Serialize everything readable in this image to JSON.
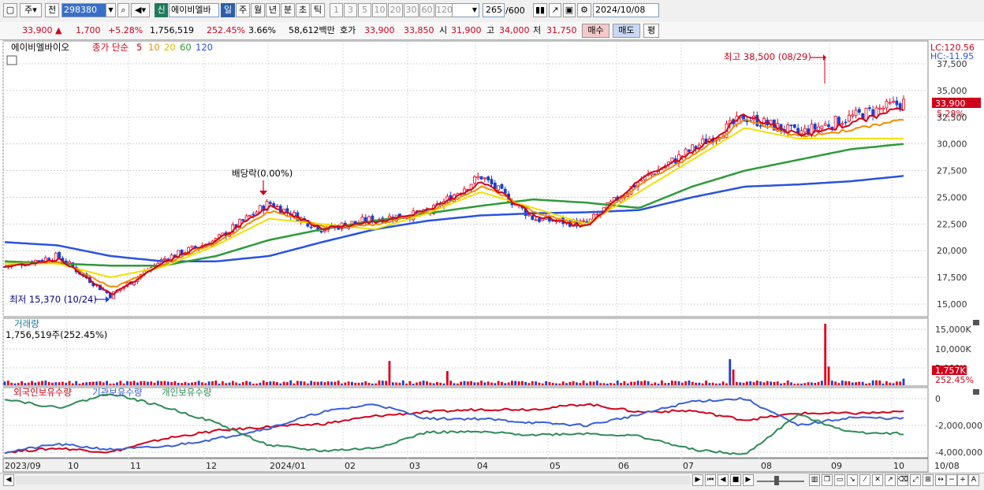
{
  "toolbar": {
    "period_type": "주",
    "prev_label": "전",
    "stock_code": "298380",
    "new_badge": "신",
    "stock_name": "에이비엘바",
    "timeframes": [
      "일",
      "주",
      "월",
      "년",
      "분",
      "초",
      "틱"
    ],
    "active_timeframe": "일",
    "intervals": [
      "1",
      "3",
      "5",
      "10",
      "20",
      "30",
      "60",
      "120"
    ],
    "count_value": "265",
    "count_total": "/600",
    "date": "2024/10/08"
  },
  "quote": {
    "price": "33,900",
    "change_arrow": "▲",
    "change": "1,700",
    "change_pct": "+5.28%",
    "volume": "1,756,519",
    "volume_ratio": "252.45%",
    "turnover": "3.66%",
    "amount": "58,612백만",
    "bid_label": "호가",
    "ask_price": "33,900",
    "bid_price": "33,850",
    "open_label": "시",
    "open": "31,900",
    "high_label": "고",
    "high": "34,000",
    "low_label": "저",
    "low": "31,750",
    "buy_label": "매수",
    "sell_label": "매도",
    "avg_label": "평"
  },
  "price_panel": {
    "stock_tag": "에이비엘바이오",
    "legend_title": "종가 단순",
    "ma_periods": [
      "5",
      "10",
      "20",
      "60",
      "120"
    ],
    "ma_colors": [
      "#d0021b",
      "#f08c00",
      "#f0e000",
      "#2e9a3a",
      "#2a52e0"
    ],
    "lc_label": "LC:120.56",
    "hc_label": "HC:-11.95",
    "y_ticks": [
      "37,500",
      "35,000",
      "32,500",
      "30,000",
      "27,500",
      "25,000",
      "22,500",
      "20,000",
      "17,500",
      "15,000"
    ],
    "last_price": "33,900",
    "last_pct": "5.28%",
    "high_annot": "최고 38,500 (08/29)",
    "low_annot": "최저 15,370 (10/24)",
    "dividend_annot": "배당락(0.00%)"
  },
  "volume_panel": {
    "title": "거래량",
    "value": "1,756,519주(252.45%)",
    "y_ticks": [
      "15,000K",
      "10,000K",
      "5,000K"
    ],
    "last_volume": "1,757K",
    "last_pct": "252.45%"
  },
  "holdings_panel": {
    "legend": [
      "외국인보유수량",
      "기관보유수량",
      "개인보유수량"
    ],
    "colors": [
      "#d0021b",
      "#3a5fd8",
      "#2e8b57"
    ],
    "y_ticks": [
      "0",
      "-2,000,000",
      "-4,000,000"
    ]
  },
  "x_axis": {
    "labels": [
      "2023/09",
      "10",
      "11",
      "12",
      "2024/01",
      "02",
      "03",
      "04",
      "05",
      "06",
      "07",
      "08",
      "09",
      "10",
      "10/08"
    ]
  },
  "chart_data": [
    {
      "type": "candlestick",
      "title": "에이비엘바이오",
      "x": [
        "2023/09",
        "2023/10",
        "2023/11",
        "2023/12",
        "2024/01",
        "2024/02",
        "2024/03",
        "2024/04",
        "2024/05",
        "2024/06",
        "2024/07",
        "2024/08",
        "2024/09",
        "2024/10/08"
      ],
      "close": [
        18500,
        19500,
        15800,
        19200,
        21000,
        24500,
        22000,
        23000,
        23500,
        27000,
        23000,
        22500,
        26500,
        29500,
        32500,
        31000,
        32500,
        33900
      ],
      "series": [
        {
          "name": "5",
          "values": [
            18500,
            19000,
            16000,
            18800,
            21000,
            24000,
            22200,
            22500,
            24000,
            26000,
            23500,
            22000,
            27000,
            29000,
            33000,
            30500,
            31500,
            33000
          ]
        },
        {
          "name": "20",
          "values": [
            18800,
            18800,
            17500,
            18500,
            20500,
            23000,
            22500,
            22000,
            23500,
            25500,
            24000,
            22500,
            25500,
            28500,
            31500,
            30500,
            30500,
            30500
          ]
        },
        {
          "name": "60",
          "values": [
            19000,
            18800,
            18600,
            18600,
            19500,
            21000,
            22000,
            22800,
            23500,
            24200,
            24800,
            24500,
            24000,
            26000,
            27500,
            28500,
            29500,
            30000
          ]
        },
        {
          "name": "120",
          "values": [
            20800,
            20500,
            19500,
            19000,
            19000,
            19500,
            20800,
            22000,
            22800,
            23300,
            23500,
            23600,
            23800,
            25000,
            26000,
            26200,
            26500,
            27000
          ]
        }
      ],
      "ylim": [
        14000,
        39000
      ],
      "annotations": [
        "최고 38,500 (08/29)",
        "최저 15,370 (10/24)",
        "배당락(0.00%)"
      ]
    },
    {
      "type": "bar",
      "title": "거래량",
      "ylim": [
        0,
        17000
      ],
      "unit": "K",
      "last": 1757
    },
    {
      "type": "line",
      "series": [
        {
          "name": "외국인보유수량",
          "values": [
            -4000000,
            -3700000,
            -4000000,
            -3000000,
            -2400000,
            -2100000,
            -1900000,
            -1300000,
            -1000000,
            -800000,
            -800000,
            -400000,
            -1000000,
            -900000,
            -1600000,
            -1100000,
            -1100000,
            -1000000
          ]
        },
        {
          "name": "기관보유수량",
          "values": [
            -4000000,
            -3400000,
            -3800000,
            -3600000,
            -3000000,
            -2200000,
            -1000000,
            -400000,
            -1500000,
            -1500000,
            -1800000,
            -2000000,
            -1200000,
            -200000,
            0,
            -2000000,
            -1400000,
            -1500000
          ]
        },
        {
          "name": "개인보유수량",
          "values": [
            0,
            -700000,
            400000,
            -600000,
            -1800000,
            -3500000,
            -3900000,
            -3700000,
            -2500000,
            -2500000,
            -2700000,
            -2600000,
            -2800000,
            -3800000,
            -4200000,
            -1200000,
            -2500000,
            -2600000
          ]
        }
      ],
      "ylim": [
        -4500000,
        500000
      ]
    }
  ]
}
